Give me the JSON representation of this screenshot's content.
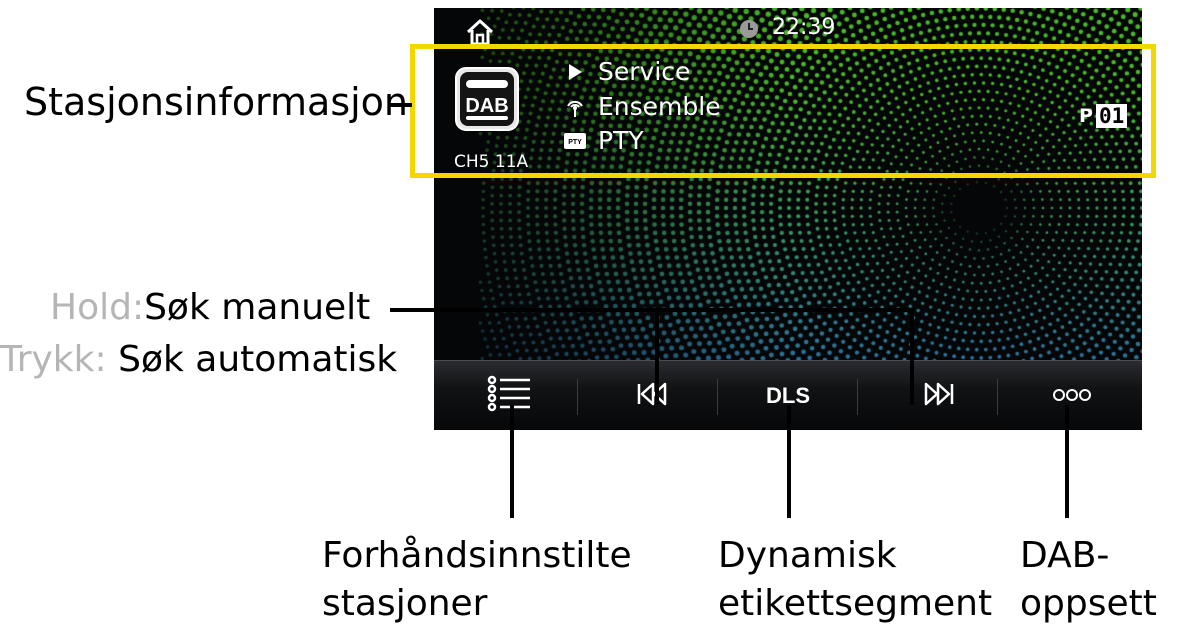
{
  "screen": {
    "clock": "22:39",
    "station": {
      "logo_text": "DAB",
      "channel": "CH5  11A",
      "service": "Service",
      "ensemble": "Ensemble",
      "pty_badge": "PTY",
      "pty": "PTY",
      "preset_prefix": "P",
      "preset_number": "01"
    },
    "controls": {
      "dls_label": "DLS"
    },
    "icons": [
      "home-icon",
      "clock-icon",
      "dab-logo-icon",
      "play-icon",
      "antenna-icon",
      "pty-icon",
      "preset-list-icon",
      "skip-back-icon",
      "skip-forward-icon",
      "more-icon"
    ],
    "colors": {
      "highlight": "#f2d800",
      "screen_bg": "#050607",
      "dot_green": "#4cc22a",
      "dot_blue": "#2a6fb0"
    }
  },
  "callouts": {
    "station_info": "Stasjonsinformasjon",
    "hold_prefix": "Hold:",
    "hold_text": "Søk manuelt",
    "press_prefix": "Trykk:",
    "press_text": "Søk automatisk",
    "presets_line1": "Forhåndsinnstilte",
    "presets_line2": "stasjoner",
    "dls_line1": "Dynamisk",
    "dls_line2": "etikettsegment",
    "setup_line1": "DAB-",
    "setup_line2": "oppsett"
  }
}
